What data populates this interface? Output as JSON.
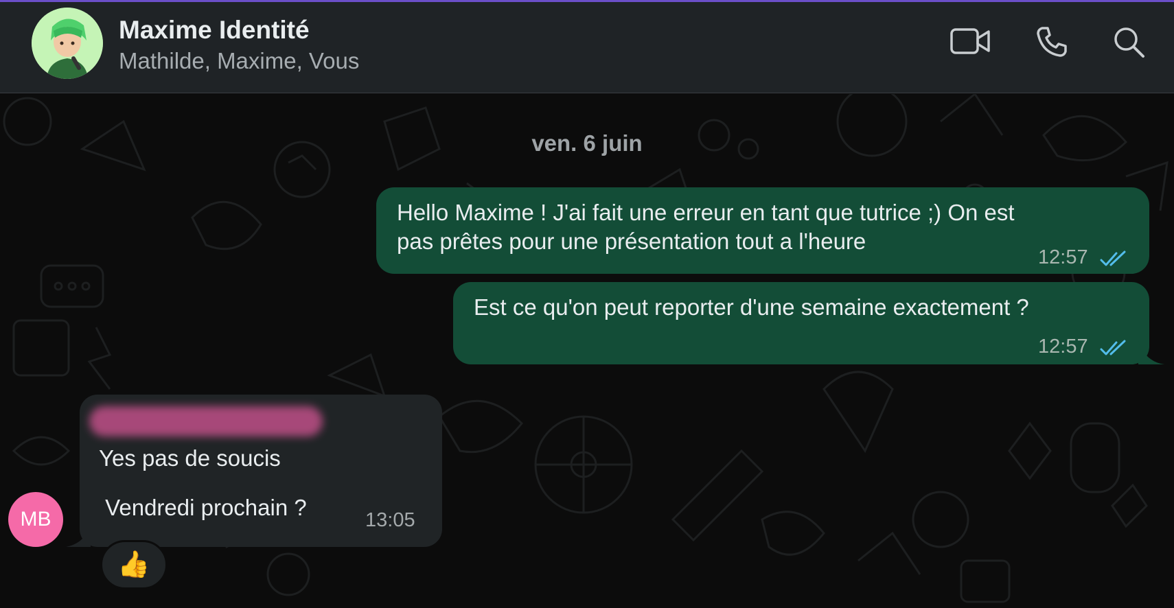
{
  "header": {
    "title": "Maxime Identité",
    "subtitle": "Mathilde, Maxime, Vous",
    "icons": [
      "group-avatar-icon",
      "video-call-icon",
      "phone-call-icon",
      "search-icon"
    ]
  },
  "chat": {
    "date_separator": "ven. 6 juin",
    "messages": [
      {
        "direction": "outgoing",
        "lines": [
          "Hello Maxime ! J'ai fait une erreur en tant que tutrice ;) On est",
          "pas prêtes pour une présentation tout a l'heure"
        ],
        "time": "12:57",
        "status": "read"
      },
      {
        "direction": "outgoing",
        "lines": [
          "Est ce qu'on peut reporter d'une semaine exactement ?"
        ],
        "time": "12:57",
        "status": "read"
      },
      {
        "direction": "incoming",
        "sender_initials": "MB",
        "lines": [
          "Yes pas de soucis",
          "",
          " Vendredi prochain ?"
        ],
        "time": "13:05",
        "reaction": "👍"
      }
    ]
  },
  "colors": {
    "header_bg": "#1f2326",
    "outgoing_bubble": "#134d37",
    "incoming_bubble": "#202426",
    "read_ticks": "#53bdeb",
    "sender_avatar": "#f56aa8",
    "top_accent": "#6b4fc8"
  }
}
